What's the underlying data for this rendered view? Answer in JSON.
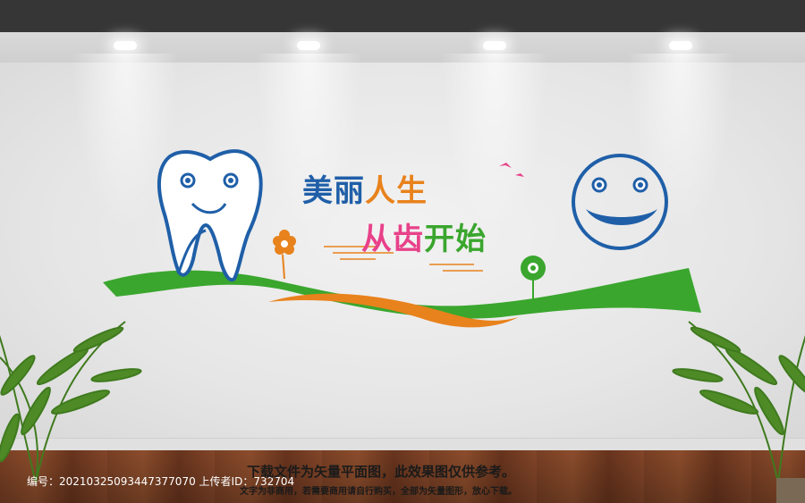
{
  "slogan": {
    "line1": [
      {
        "text": "美丽",
        "color": "#1f5fa8"
      },
      {
        "text": "人生",
        "color": "#e8821c"
      }
    ],
    "line2": [
      {
        "text": "从齿",
        "color": "#e8418a"
      },
      {
        "text": "开始",
        "color": "#3aa62e"
      }
    ]
  },
  "watermark": {
    "id_label": "编号：",
    "id_value": "20210325093447377070",
    "uploader_label": "上传者ID：",
    "uploader_value": "732704",
    "notice": "下载文件为矢量平面图，此效果图仅供参考。",
    "note": "文字为非商用，若需要商用请自行购买，全部为矢量图形，放心下载。"
  },
  "colors": {
    "blue": "#1f5fa8",
    "green": "#3aa62e",
    "orange": "#e8821c",
    "pink": "#e8418a",
    "wall": "#ececec",
    "floor": "#8d4a2a"
  },
  "icons": [
    "tooth-icon",
    "smiley-icon",
    "flower-icon",
    "bird-icon",
    "plant-icon"
  ]
}
